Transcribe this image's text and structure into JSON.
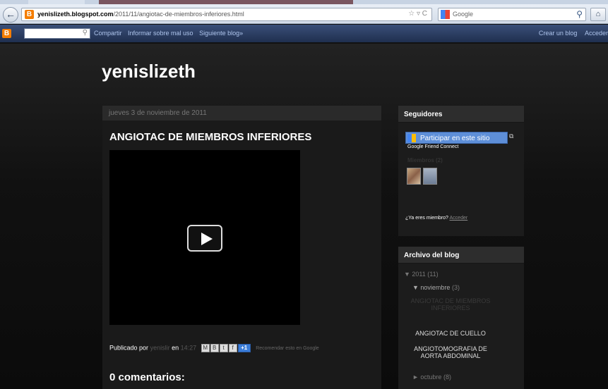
{
  "browser": {
    "url_domain": "yenislizeth.blogspot.com",
    "url_path": "/2011/11/angiotac-de-miembros-inferiores.html",
    "url_icons": "☆ ▿ C",
    "search_engine": "Google"
  },
  "blogger_nav": {
    "links": [
      "Compartir",
      "Informar sobre mal uso",
      "Siguiente blog»"
    ],
    "right_links": [
      "Crear un blog",
      "Acceder"
    ]
  },
  "blog": {
    "title": "yenislizeth"
  },
  "post": {
    "date": "jueves 3 de noviembre de 2011",
    "title": "ANGIOTAC DE MIEMBROS INFERIORES",
    "published_by_label": "Publicado por",
    "author": "yenislir",
    "at_label": "en",
    "time": "14:27",
    "recommend": "Recomendar esto en Google",
    "comments_title": "0 comentarios:"
  },
  "followers_widget": {
    "title": "Seguidores",
    "join_button": "Participar en este sitio",
    "gfc": "Google Friend Connect",
    "members": "Miembros (2)",
    "already_member": "¿Ya eres miembro?",
    "sign_in": "Acceder"
  },
  "archive_widget": {
    "title": "Archivo del blog",
    "year": "▼ 2011",
    "year_count": "(11)",
    "month": "▼ noviembre",
    "month_count": "(3)",
    "posts": [
      "ANGIOTAC DE MIEMBROS INFERIORES",
      "ANGIOTAC DE CUELLO",
      "ANGIOTOMOGRAFIA DE AORTA ABDOMINAL"
    ],
    "prev_month": "► octubre",
    "prev_month_count": "(8)"
  }
}
